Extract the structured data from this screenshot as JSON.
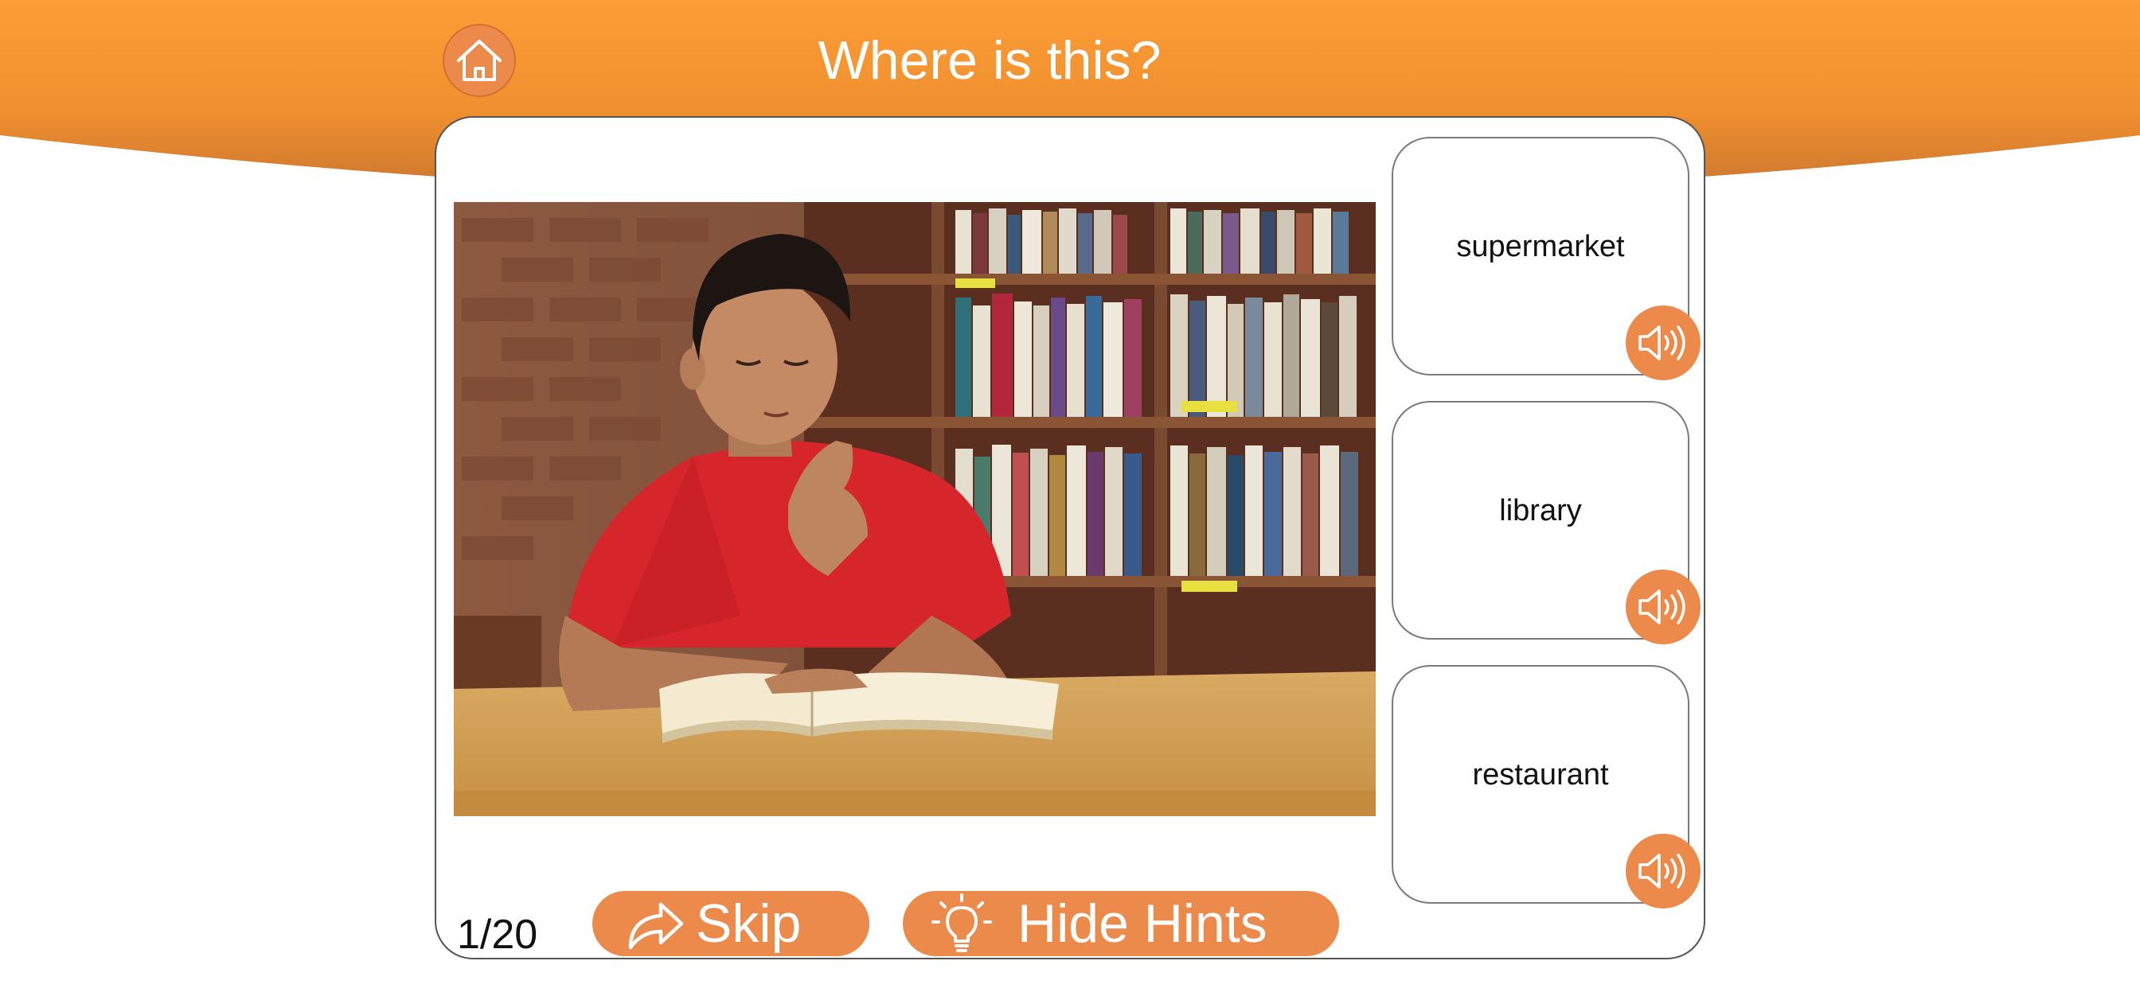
{
  "header": {
    "title": "Where is this?",
    "home_icon": "home-icon",
    "band_color": "#f99b35"
  },
  "question": {
    "image_description_icon": "photo",
    "options": [
      {
        "label": "supermarket",
        "audio_icon": "speaker-icon"
      },
      {
        "label": "library",
        "audio_icon": "speaker-icon"
      },
      {
        "label": "restaurant",
        "audio_icon": "speaker-icon"
      }
    ]
  },
  "footer": {
    "progress": "1/20",
    "skip_label": "Skip",
    "skip_icon": "share-arrow-icon",
    "hints_label": "Hide Hints",
    "hints_icon": "lightbulb-icon"
  },
  "colors": {
    "accent": "#ec8a4c",
    "header_top": "#fa9a33",
    "header_bottom": "#d9792c"
  }
}
